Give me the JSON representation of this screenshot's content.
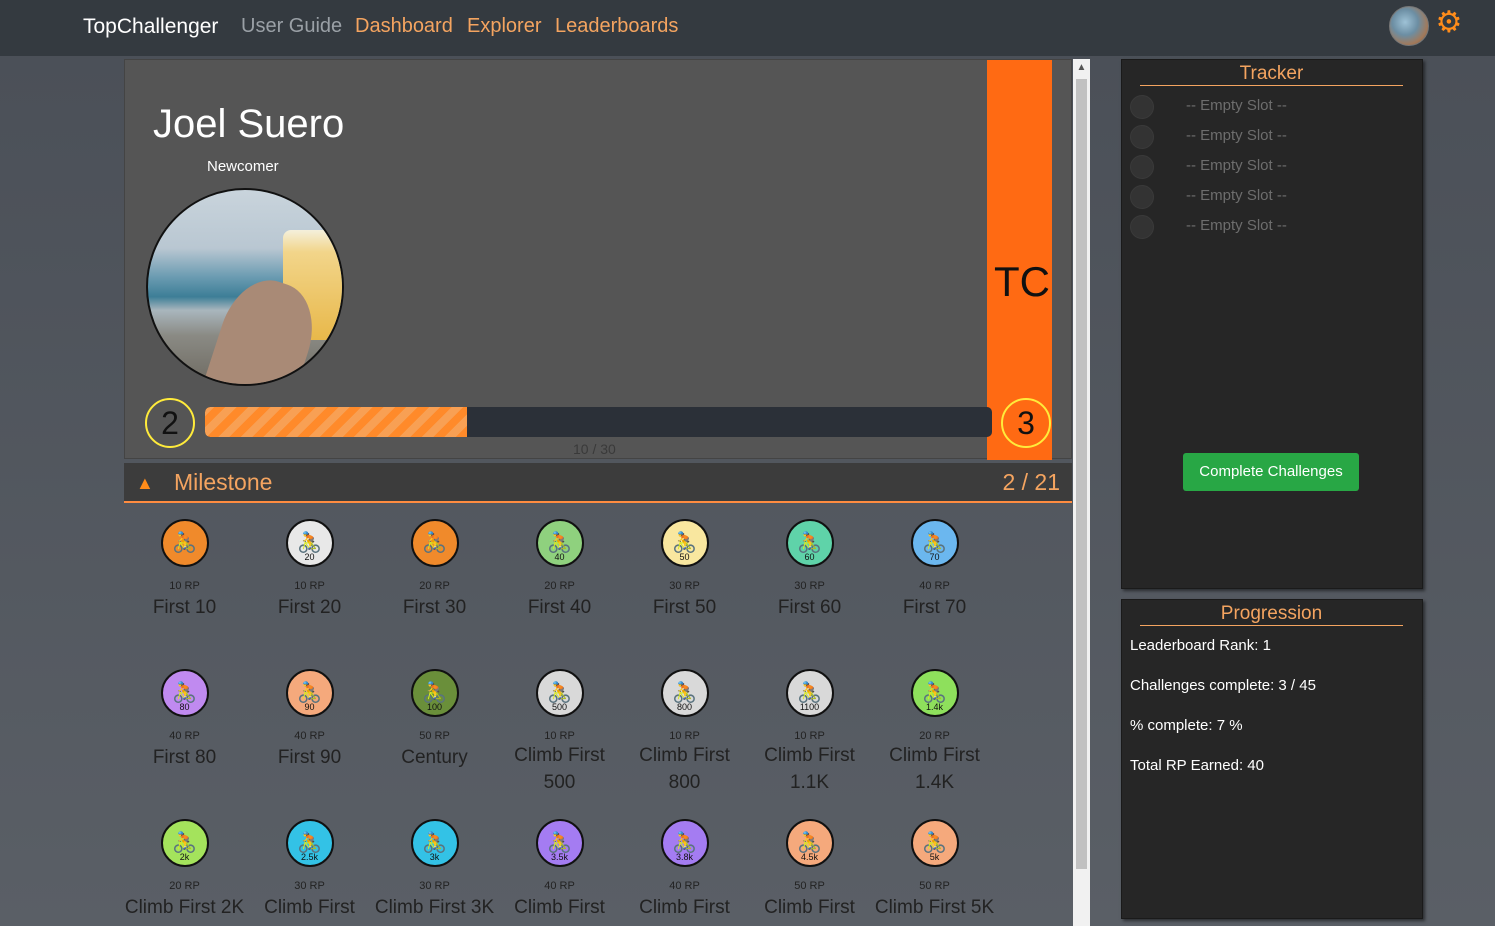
{
  "nav": {
    "brand": "TopChallenger",
    "links": [
      "User Guide",
      "Dashboard",
      "Explorer",
      "Leaderboards"
    ]
  },
  "profile": {
    "name": "Joel Suero",
    "rank_title": "Newcomer",
    "tc_label": "TC",
    "level_current": "2",
    "level_next": "3",
    "xp_text": "10 / 30",
    "xp_fraction": 0.333
  },
  "milestone": {
    "title": "Milestone",
    "count": "2 / 21",
    "badges": [
      {
        "rp": "10 RP",
        "name": "First 10",
        "num": "",
        "color": "#f08a2b"
      },
      {
        "rp": "10 RP",
        "name": "First 20",
        "num": "20",
        "color": "#e8e8e8"
      },
      {
        "rp": "20 RP",
        "name": "First 30",
        "num": "",
        "color": "#f08a2b"
      },
      {
        "rp": "20 RP",
        "name": "First 40",
        "num": "40",
        "color": "#8fd17e"
      },
      {
        "rp": "30 RP",
        "name": "First 50",
        "num": "50",
        "color": "#f9e79f"
      },
      {
        "rp": "30 RP",
        "name": "First 60",
        "num": "60",
        "color": "#5fd3a9"
      },
      {
        "rp": "40 RP",
        "name": "First 70",
        "num": "70",
        "color": "#6bb7ef"
      },
      {
        "rp": "40 RP",
        "name": "First 80",
        "num": "80",
        "color": "#c08af0"
      },
      {
        "rp": "40 RP",
        "name": "First 90",
        "num": "90",
        "color": "#f5a97c"
      },
      {
        "rp": "50 RP",
        "name": "Century",
        "num": "100",
        "color": "#6a8f3a"
      },
      {
        "rp": "10 RP",
        "name": "Climb First 500",
        "num": "500",
        "color": "#d9d9d9"
      },
      {
        "rp": "10 RP",
        "name": "Climb First 800",
        "num": "800",
        "color": "#d9d9d9"
      },
      {
        "rp": "10 RP",
        "name": "Climb First 1.1K",
        "num": "1100",
        "color": "#d9d9d9"
      },
      {
        "rp": "20 RP",
        "name": "Climb First 1.4K",
        "num": "1.4k",
        "color": "#8ee05c"
      },
      {
        "rp": "20 RP",
        "name": "Climb First 2K",
        "num": "2k",
        "color": "#a4e35c"
      },
      {
        "rp": "30 RP",
        "name": "Climb First",
        "num": "2.5k",
        "color": "#33c2e6"
      },
      {
        "rp": "30 RP",
        "name": "Climb First 3K",
        "num": "3k",
        "color": "#33c2e6"
      },
      {
        "rp": "40 RP",
        "name": "Climb First",
        "num": "3.5k",
        "color": "#a47cf2"
      },
      {
        "rp": "40 RP",
        "name": "Climb First",
        "num": "3.8k",
        "color": "#a47cf2"
      },
      {
        "rp": "50 RP",
        "name": "Climb First",
        "num": "4.5k",
        "color": "#f5a97c"
      },
      {
        "rp": "50 RP",
        "name": "Climb First 5K",
        "num": "5k",
        "color": "#f5a97c"
      }
    ]
  },
  "tracker": {
    "title": "Tracker",
    "slots": [
      "-- Empty Slot --",
      "-- Empty Slot --",
      "-- Empty Slot --",
      "-- Empty Slot --",
      "-- Empty Slot --"
    ],
    "button": "Complete Challenges"
  },
  "progression": {
    "title": "Progression",
    "lines": [
      "Leaderboard Rank: 1",
      "Challenges complete: 3 / 45",
      "% complete: 7 %",
      "Total RP Earned: 40"
    ]
  }
}
